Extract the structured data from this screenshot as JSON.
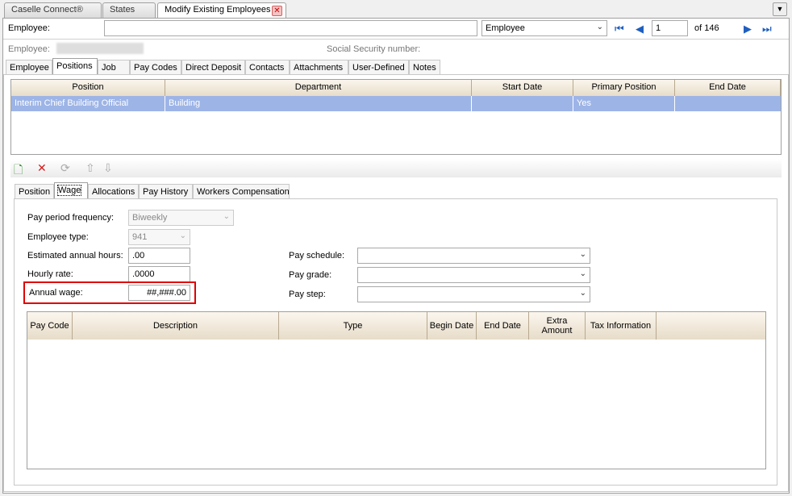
{
  "doc_tabs": [
    {
      "label": "Caselle Connect®"
    },
    {
      "label": "States"
    },
    {
      "label": "Modify Existing Employees"
    }
  ],
  "employee_search": {
    "label": "Employee:",
    "value": ""
  },
  "search_type": {
    "value": "Employee"
  },
  "record_nav": {
    "current": "1",
    "of_label": "of 146"
  },
  "employee_header": {
    "employee_label": "Employee:",
    "ssn_label": "Social Security number:"
  },
  "main_tabs": [
    "Employee",
    "Positions",
    "Job",
    "Pay Codes",
    "Direct Deposit",
    "Contacts",
    "Attachments",
    "User-Defined",
    "Notes"
  ],
  "positions_grid": {
    "columns": [
      "Position",
      "Department",
      "Start Date",
      "Primary Position",
      "End Date"
    ],
    "rows": [
      {
        "position": "Interim Chief Building Official",
        "department": "Building",
        "start_date": "",
        "primary": "Yes",
        "end_date": ""
      }
    ]
  },
  "sub_tabs": [
    "Position",
    "Wage",
    "Allocations",
    "Pay History",
    "Workers Compensation"
  ],
  "wage": {
    "pay_period_frequency_label": "Pay period frequency:",
    "pay_period_frequency_value": "Biweekly",
    "employee_type_label": "Employee type:",
    "employee_type_value": "941",
    "estimated_hours_label": "Estimated annual hours:",
    "estimated_hours_value": ".00",
    "hourly_rate_label": "Hourly rate:",
    "hourly_rate_value": ".0000",
    "annual_wage_label": "Annual wage:",
    "annual_wage_value": "##,###.00",
    "pay_schedule_label": "Pay schedule:",
    "pay_grade_label": "Pay grade:",
    "pay_step_label": "Pay step:"
  },
  "paycode_grid": {
    "columns": [
      "Pay Code",
      "Description",
      "Type",
      "Begin Date",
      "End Date",
      "Extra Amount",
      "Tax Information"
    ]
  },
  "colors": {
    "highlight_border": "#e00000",
    "selection": "#9db4e6"
  }
}
